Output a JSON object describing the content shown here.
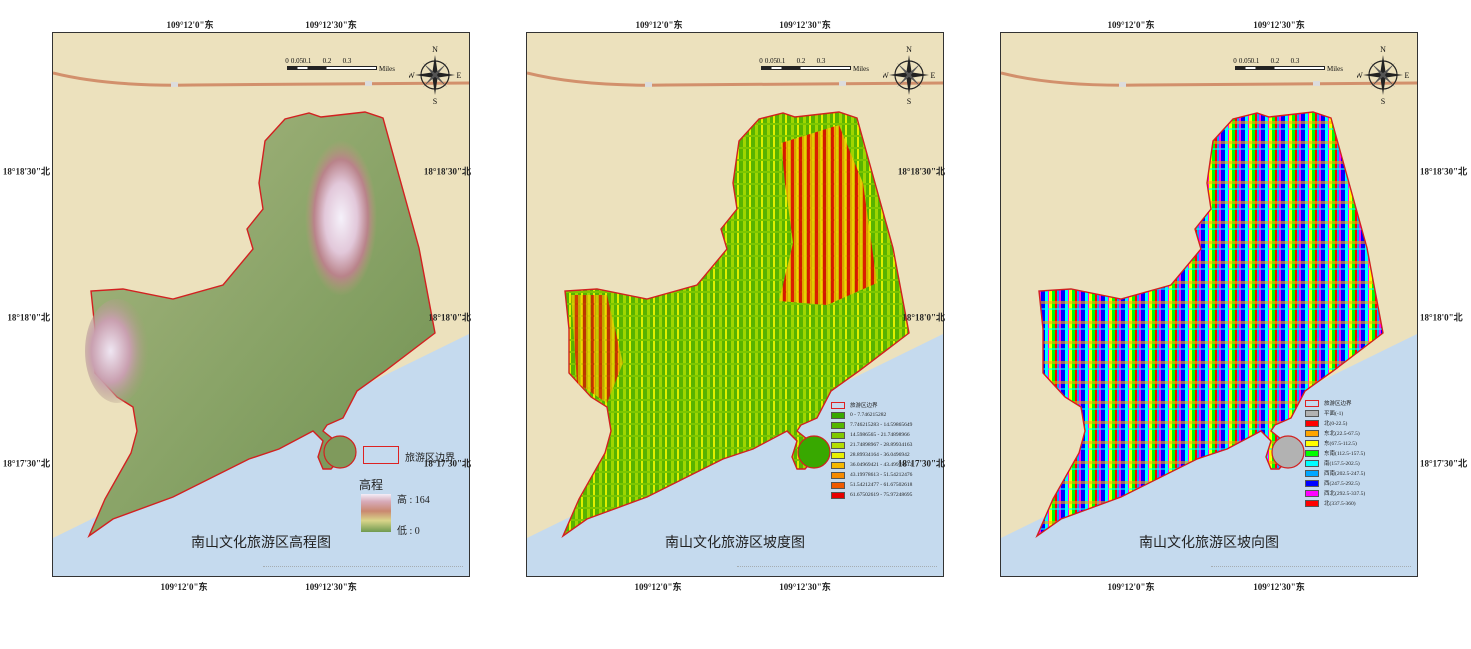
{
  "coords": {
    "top": [
      "109°12'0\"东",
      "109°12'30\"东"
    ],
    "bottom": [
      "109°12'0\"东",
      "109°12'30\"东"
    ],
    "left": [
      "18°18'30\"北",
      "18°18'0\"北",
      "18°17'30\"北"
    ],
    "right": [
      "18°18'30\"北",
      "18°18'0\"北",
      "18°17'30\"北"
    ]
  },
  "scalebar": {
    "ticks": [
      "0",
      "0.05",
      "0.1",
      "0.2",
      "0.3"
    ],
    "unit": "Miles"
  },
  "compass": {
    "n": "N",
    "s": "S",
    "e": "E",
    "w": "W"
  },
  "panels": [
    {
      "title": "南山文化旅游区高程图",
      "legend": {
        "boundary_label": "旅游区边界",
        "heading": "高程",
        "high_label": "高 : 164",
        "low_label": "低 : 0",
        "ramp_colors": [
          "#f3eef8",
          "#d7aab8",
          "#c98870",
          "#d9d58a",
          "#6f9a50"
        ]
      }
    },
    {
      "title": "南山文化旅游区坡度图",
      "legend": {
        "boundary_label": "旅游区边界",
        "classes": [
          {
            "label": "0 - 7.746215282",
            "color": "#38a800"
          },
          {
            "label": "7.746215283 - 14.59865649",
            "color": "#55b700"
          },
          {
            "label": "14.5986565 - 21.74898966",
            "color": "#7fc900"
          },
          {
            "label": "21.74898967 - 28.89934163",
            "color": "#b3dd00"
          },
          {
            "label": "28.89934164 - 36.0496942",
            "color": "#e8f000"
          },
          {
            "label": "36.04969421 - 43.49978612",
            "color": "#f5b800"
          },
          {
            "label": "43.19978613 - 51.54212476",
            "color": "#f58a00"
          },
          {
            "label": "51.54212477 - 61.67502618",
            "color": "#ef5a00"
          },
          {
            "label": "61.67502619 - 75.97248695",
            "color": "#e60000"
          }
        ]
      }
    },
    {
      "title": "南山文化旅游区坡向图",
      "legend": {
        "boundary_label": "旅游区边界",
        "classes": [
          {
            "label": "平面(-1)",
            "color": "#b2b2b2"
          },
          {
            "label": "北(0-22.5)",
            "color": "#ff0000"
          },
          {
            "label": "东北(22.5-67.5)",
            "color": "#ffa500"
          },
          {
            "label": "东(67.5-112.5)",
            "color": "#ffff00"
          },
          {
            "label": "东南(112.5-157.5)",
            "color": "#00ff00"
          },
          {
            "label": "南(157.5-202.5)",
            "color": "#00ffff"
          },
          {
            "label": "西南(202.5-247.5)",
            "color": "#00a6ff"
          },
          {
            "label": "西(247.5-292.5)",
            "color": "#0000ff"
          },
          {
            "label": "西北(292.5-337.5)",
            "color": "#ff00ff"
          },
          {
            "label": "北(337.5-360)",
            "color": "#ff0000"
          }
        ]
      }
    }
  ],
  "colors": {
    "land": "#ece1bd",
    "sea": "#c5daee",
    "road": "#d2906c",
    "boundary": "#d22020"
  }
}
